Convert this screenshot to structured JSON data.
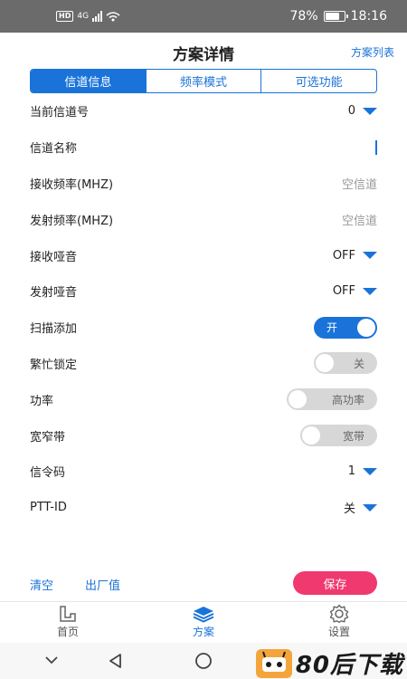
{
  "status": {
    "left_badge": "HD",
    "network": "4G",
    "battery": "78%",
    "battery_level": 0.78,
    "time": "18:16"
  },
  "header": {
    "title": "方案详情",
    "plan_list": "方案列表"
  },
  "tabs": [
    {
      "label": "信道信息",
      "active": true
    },
    {
      "label": "频率模式",
      "active": false
    },
    {
      "label": "可选功能",
      "active": false
    }
  ],
  "rows": {
    "current_channel": {
      "label": "当前信道号",
      "value": "0"
    },
    "channel_name": {
      "label": "信道名称",
      "value": ""
    },
    "rx_freq": {
      "label": "接收频率(MHZ)",
      "placeholder": "空信道"
    },
    "tx_freq": {
      "label": "发射频率(MHZ)",
      "placeholder": "空信道"
    },
    "rx_squelch": {
      "label": "接收哑音",
      "value": "OFF"
    },
    "tx_squelch": {
      "label": "发射哑音",
      "value": "OFF"
    },
    "scan_add": {
      "label": "扫描添加",
      "toggle": "开",
      "on": true
    },
    "busy_lock": {
      "label": "繁忙锁定",
      "toggle": "关",
      "on": false
    },
    "power": {
      "label": "功率",
      "toggle": "高功率",
      "on": false
    },
    "bandwidth": {
      "label": "宽窄带",
      "toggle": "宽带",
      "on": false
    },
    "signaling": {
      "label": "信令码",
      "value": "1"
    },
    "ptt_id": {
      "label": "PTT-ID",
      "value": "关"
    }
  },
  "actions": {
    "clear": "清空",
    "factory": "出厂值",
    "save": "保存"
  },
  "tabbar": [
    {
      "label": "首页",
      "icon": "home-icon"
    },
    {
      "label": "方案",
      "icon": "layers-icon",
      "active": true
    },
    {
      "label": "设置",
      "icon": "gear-icon"
    }
  ],
  "watermark": "80后下载",
  "colors": {
    "accent": "#1a73d9",
    "save": "#f0396f"
  }
}
